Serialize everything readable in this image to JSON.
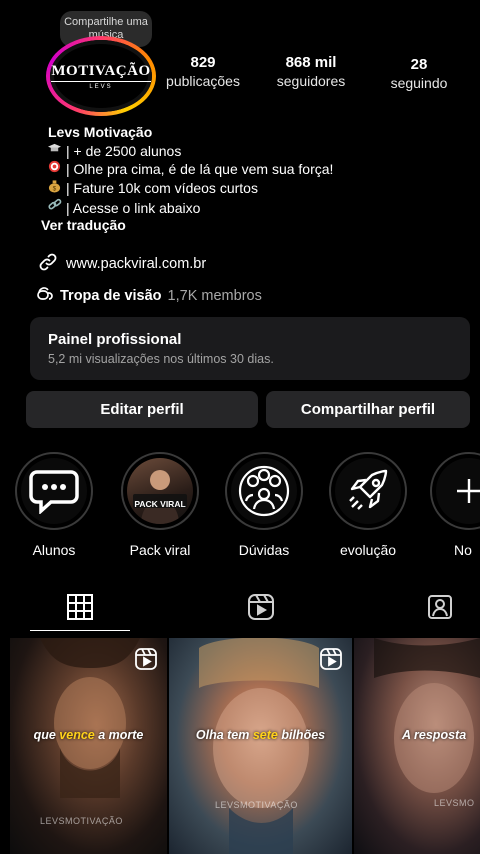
{
  "note": {
    "text": "Compartilhe uma música"
  },
  "avatar": {
    "logo_main": "MOTIVAÇÃO",
    "logo_sub": "LEVS"
  },
  "stats": [
    {
      "num": "829",
      "label": "publicações"
    },
    {
      "num": "868 mil",
      "label": "seguidores"
    },
    {
      "num": "28",
      "label": "seguindo"
    }
  ],
  "bio": {
    "name": "Levs Motivação",
    "lines": [
      {
        "icon": "graduation-cap-icon",
        "text": "| + de 2500 alunos"
      },
      {
        "icon": "target-icon",
        "text": "| Olhe pra cima, é de lá que vem sua força!"
      },
      {
        "icon": "money-bag-icon",
        "text": "| Fature 10k com vídeos curtos"
      },
      {
        "icon": "chain-link-icon",
        "text": "| Acesse o link abaixo"
      }
    ],
    "translate": "Ver tradução"
  },
  "link": {
    "url": "www.packviral.com.br"
  },
  "channel": {
    "name": "Tropa de visão",
    "members": "1,7K membros"
  },
  "panel": {
    "title": "Painel profissional",
    "subtitle": "5,2 mi visualizações nos últimos 30 dias."
  },
  "buttons": {
    "edit": "Editar perfil",
    "share": "Compartilhar perfil"
  },
  "highlights": [
    {
      "label": "Alunos",
      "icon": "chat-bubble-icon"
    },
    {
      "label": "Pack viral",
      "icon": "pack-viral-thumbnail",
      "badge": "PACK VIRAL"
    },
    {
      "label": "Dúvidas",
      "icon": "questions-group-icon"
    },
    {
      "label": "evolução",
      "icon": "rocket-icon"
    },
    {
      "label": "No",
      "icon": "plus-icon"
    }
  ],
  "tabs": [
    {
      "name": "grid",
      "icon": "grid-icon"
    },
    {
      "name": "reels",
      "icon": "reels-icon"
    },
    {
      "name": "tagged",
      "icon": "tagged-user-icon"
    }
  ],
  "posts": [
    {
      "caption_pre": "que ",
      "caption_hi": "vence",
      "caption_post": " a morte",
      "watermark": "LEVSMOTIVAÇÃO",
      "reel": true
    },
    {
      "caption_pre": "Olha tem ",
      "caption_hi": "sete",
      "caption_post": " bilhões",
      "watermark": "LEVSMOTIVAÇÃO",
      "reel": true
    },
    {
      "caption_pre": "A resposta",
      "caption_hi": "",
      "caption_post": "",
      "watermark": "LEVSMO",
      "reel": false
    }
  ],
  "colors": {
    "background": "#000000",
    "button": "#262628",
    "panel": "#1b1b1d",
    "caption_highlight": "#ffd21a"
  }
}
